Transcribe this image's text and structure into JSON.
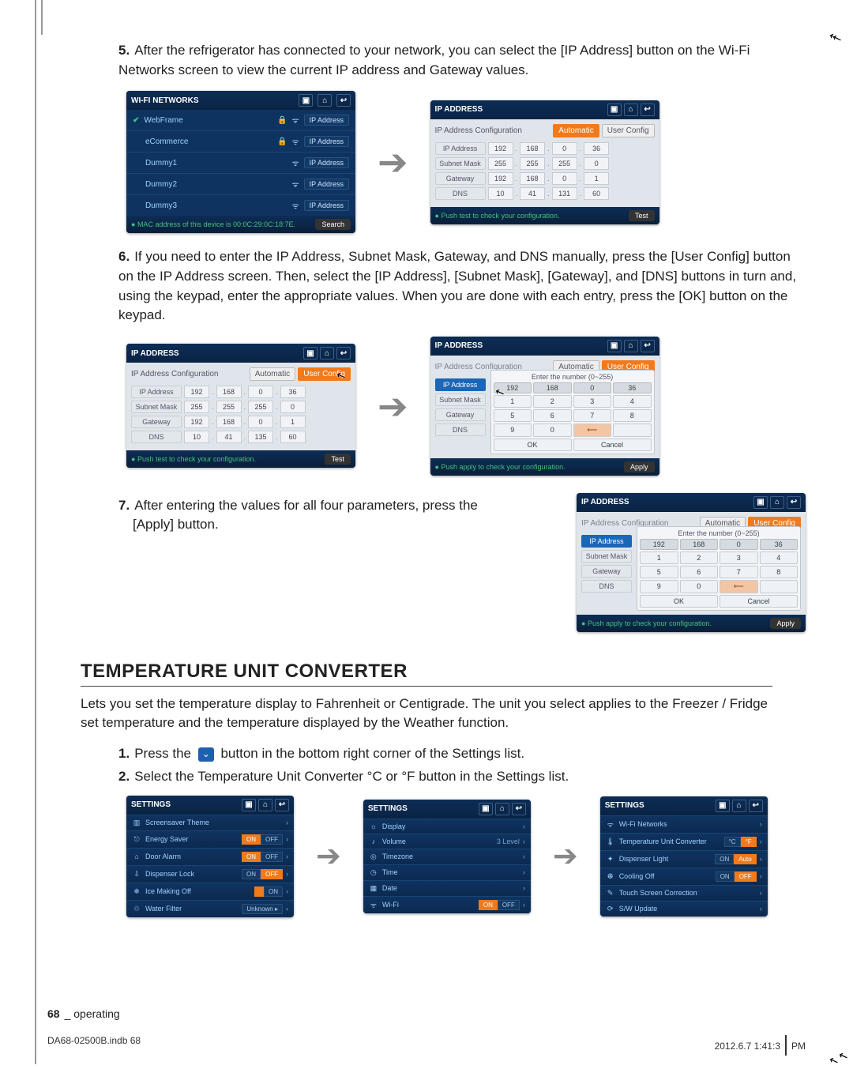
{
  "steps": {
    "s5": "After the refrigerator has connected to your network, you can select the [IP Address] button on the Wi-Fi Networks screen to view the current IP address and Gateway values.",
    "s6": "If you need to enter the IP Address, Subnet Mask, Gateway, and DNS manually, press the [User Config] button on the IP Address screen. Then, select the [IP Address], [Subnet Mask], [Gateway], and [DNS] buttons in turn and, using the keypad, enter the appropriate values. When you are done with each entry, press the [OK] button on the keypad.",
    "s7a": "After entering the values for all four parameters, press the",
    "s7b": "[Apply] button."
  },
  "wifi_panel": {
    "title": "WI-FI NETWORKS",
    "items": [
      "WebFrame",
      "eCommerce",
      "Dummy1",
      "Dummy2",
      "Dummy3"
    ],
    "item_btn": "IP Address",
    "footer_left": "MAC address of this device is 00:0C:29:0C:18:7E.",
    "footer_btn": "Search"
  },
  "ip_panel": {
    "title": "IP ADDRESS",
    "cfg_label": "IP Address Configuration",
    "tab_auto": "Automatic",
    "tab_user": "User Config",
    "rows": {
      "IP Address": [
        "192",
        "168",
        "0",
        "36"
      ],
      "Subnet Mask": [
        "255",
        "255",
        "255",
        "0"
      ],
      "Gateway": [
        "192",
        "168",
        "0",
        "1"
      ],
      "DNS": [
        "10",
        "41",
        "131",
        "60"
      ]
    },
    "dns_alt": [
      "10",
      "41",
      "135",
      "60"
    ],
    "footer_push": "Push test to check your configuration.",
    "footer_push_apply": "Push apply to check your configuration.",
    "footer_btn_test": "Test",
    "footer_btn_apply": "Apply"
  },
  "keypad": {
    "title": "Enter the number (0~255)",
    "top": [
      "192",
      "168",
      "0",
      "36"
    ],
    "keys": [
      "1",
      "2",
      "3",
      "4",
      "5",
      "6",
      "7",
      "8",
      "9",
      "0"
    ],
    "ok": "OK",
    "cancel": "Cancel"
  },
  "section": {
    "title": "Temperature Unit Converter",
    "para": "Lets you set the temperature display to Fahrenheit or Centigrade. The unit you select applies to the Freezer / Fridge set temperature and the temperature displayed by the Weather function.",
    "s1a": "Press the ",
    "s1b": " button in the bottom right corner of the Settings list.",
    "s2": "Select the Temperature Unit Converter °C or °F button in the Settings list."
  },
  "settings1": {
    "title": "SETTINGS",
    "items": [
      {
        "icon": "▥",
        "name": "Screensaver Theme",
        "right": ""
      },
      {
        "icon": "⎋",
        "name": "Energy Saver",
        "toggle": [
          "ON",
          "OFF"
        ],
        "on": 0
      },
      {
        "icon": "⌂",
        "name": "Door Alarm",
        "toggle": [
          "ON",
          "OFF"
        ],
        "on": 0
      },
      {
        "icon": "⇩",
        "name": "Dispenser Lock",
        "toggle": [
          "ON",
          "OFF"
        ],
        "on": 1
      },
      {
        "icon": "❄",
        "name": "Ice Making Off",
        "toggle": [
          " ",
          "ON"
        ],
        "on": 0
      },
      {
        "icon": "♲",
        "name": "Water Filter",
        "replace": "Unknown"
      }
    ]
  },
  "settings2": {
    "title": "SETTINGS",
    "items": [
      {
        "icon": "☼",
        "name": "Display",
        "right": ""
      },
      {
        "icon": "♪",
        "name": "Volume",
        "right": "3 Level"
      },
      {
        "icon": "◎",
        "name": "Timezone",
        "right": ""
      },
      {
        "icon": "◷",
        "name": "Time",
        "right": ""
      },
      {
        "icon": "▦",
        "name": "Date",
        "right": ""
      },
      {
        "icon": "ᯤ",
        "name": "Wi-Fi",
        "toggle": [
          "ON",
          "OFF"
        ],
        "on": 0
      }
    ]
  },
  "settings3": {
    "title": "SETTINGS",
    "items": [
      {
        "icon": "ᯤ",
        "name": "Wi-Fi Networks",
        "right": ""
      },
      {
        "icon": "🌡",
        "name": "Temperature Unit Converter",
        "toggle": [
          "°C",
          "°F"
        ],
        "on": 1
      },
      {
        "icon": "✦",
        "name": "Dispenser Light",
        "toggle": [
          "ON",
          "Auto"
        ],
        "on": 1
      },
      {
        "icon": "❆",
        "name": "Cooling Off",
        "toggle": [
          "ON",
          "OFF"
        ],
        "on": 1
      },
      {
        "icon": "✎",
        "name": "Touch Screen Correction",
        "right": ""
      },
      {
        "icon": "⟳",
        "name": "S/W Update",
        "right": ""
      }
    ]
  },
  "footer": {
    "page": "68",
    "section": "operating",
    "file": "DA68-02500B.indb   68",
    "date": "2012.6.7   1:41:3",
    "ampm": "PM"
  }
}
